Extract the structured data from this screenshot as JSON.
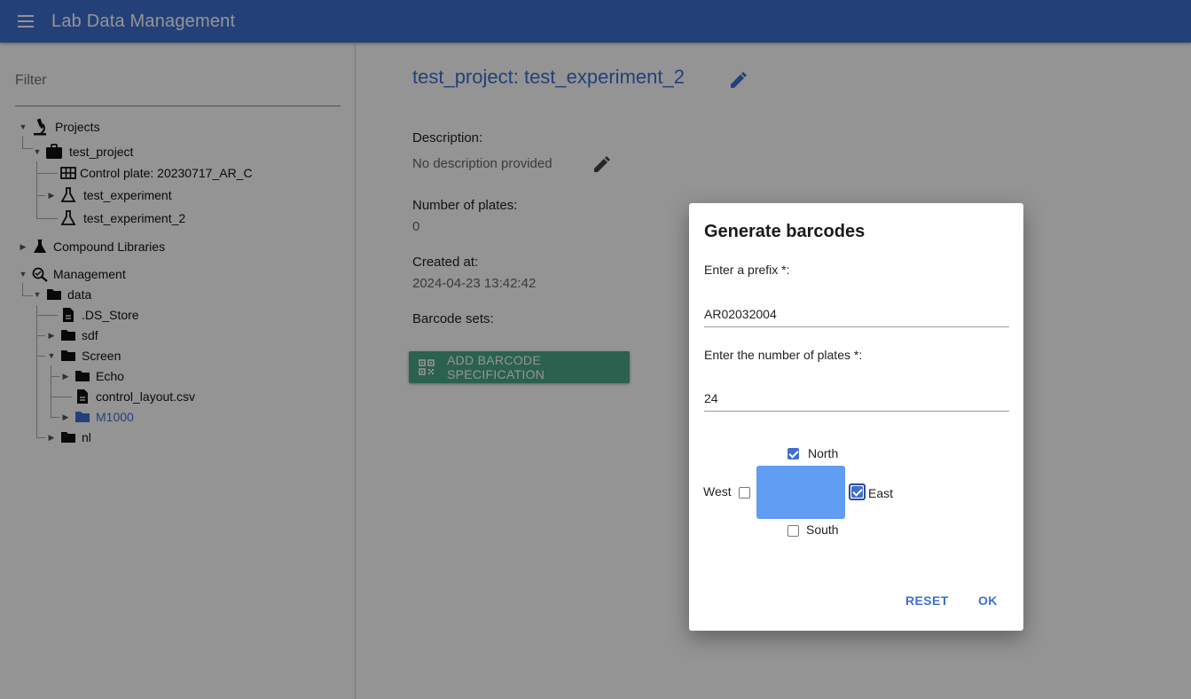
{
  "app": {
    "title": "Lab Data Management"
  },
  "sidebar": {
    "filter_placeholder": "Filter",
    "tree": {
      "projects": "Projects",
      "test_project": "test_project",
      "control_plate": "Control plate: 20230717_AR_C",
      "test_experiment": "test_experiment",
      "test_experiment_2": "test_experiment_2",
      "compound_libraries": "Compound Libraries",
      "management": "Management",
      "data": "data",
      "ds_store": ".DS_Store",
      "sdf": "sdf",
      "screen": "Screen",
      "echo": "Echo",
      "control_layout": "control_layout.csv",
      "m1000": "M1000",
      "nl": "nl"
    }
  },
  "main": {
    "title": "test_project: test_experiment_2",
    "description_label": "Description:",
    "description_value": "No description provided",
    "plates_label": "Number of plates:",
    "plates_value": "0",
    "created_label": "Created at:",
    "created_value": "2024-04-23 13:42:42",
    "barcode_label": "Barcode sets:",
    "add_button": "ADD BARCODE SPECIFICATION"
  },
  "dialog": {
    "title": "Generate barcodes",
    "prefix_label": "Enter a prefix *:",
    "prefix_value": "AR02032004",
    "plates_label": "Enter the number of plates *:",
    "plates_value": "24",
    "directions": {
      "north": {
        "label": "North",
        "checked": true
      },
      "west": {
        "label": "West",
        "checked": false
      },
      "east": {
        "label": "East",
        "checked": true
      },
      "south": {
        "label": "South",
        "checked": false
      }
    },
    "reset_label": "RESET",
    "ok_label": "OK"
  },
  "colors": {
    "primary": "#3f6fd1",
    "accent_button": "#4aa889",
    "plate_box": "#5f9cf2"
  }
}
